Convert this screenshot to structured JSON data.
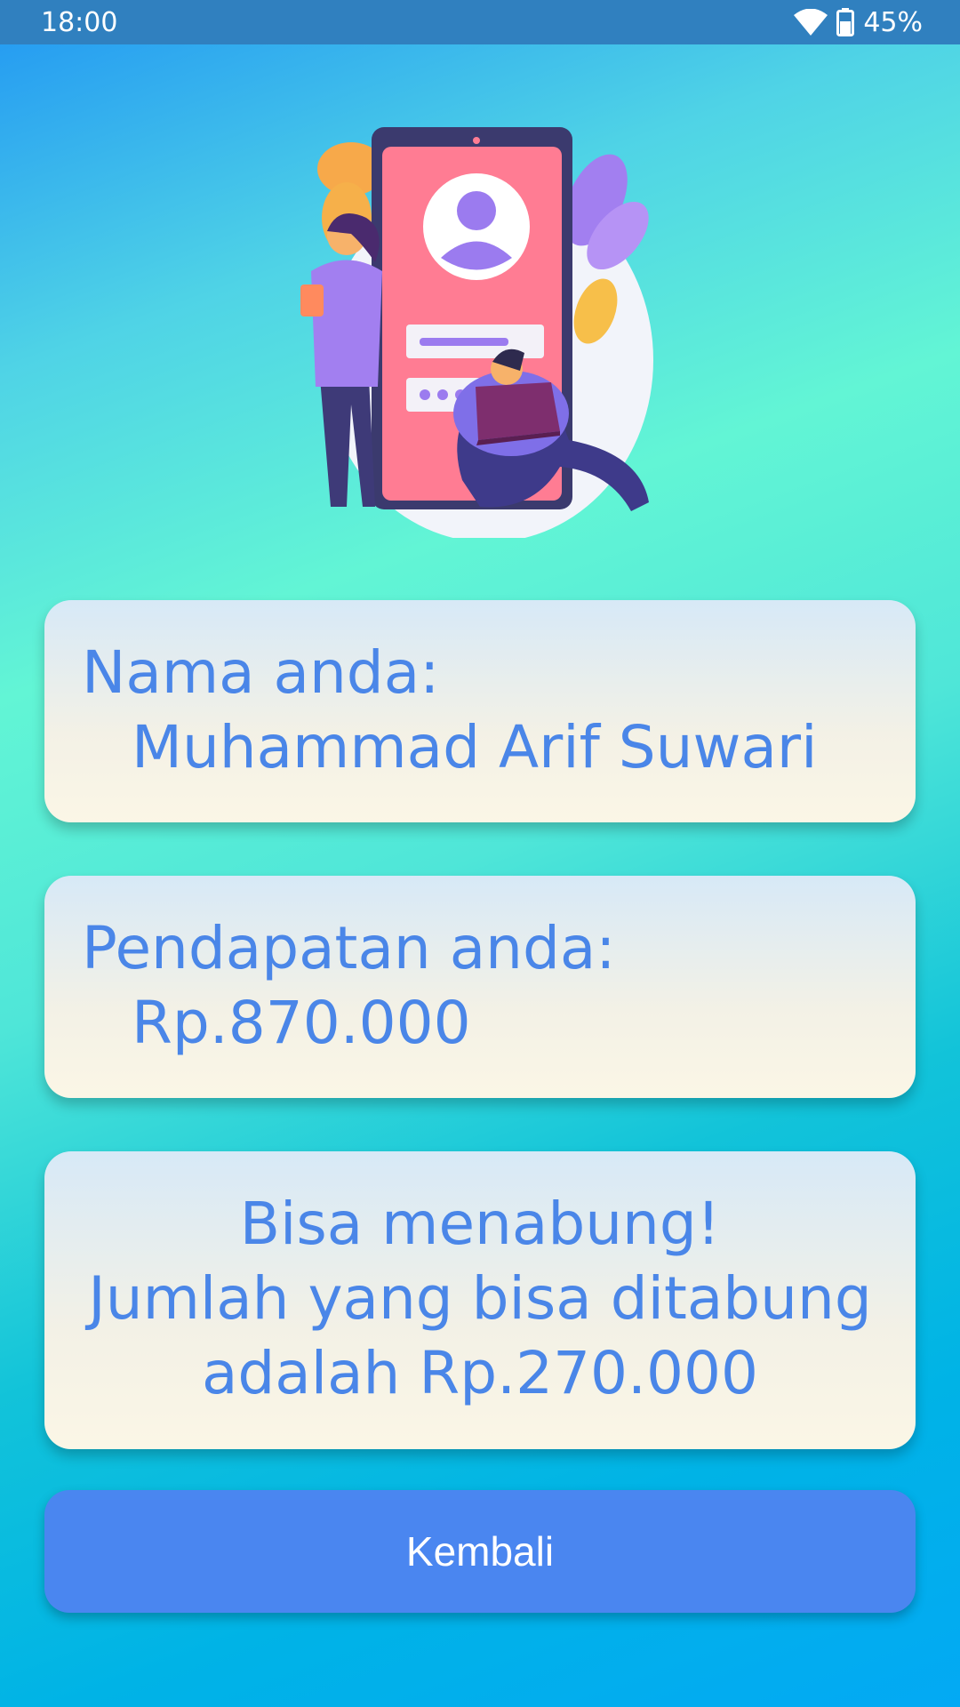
{
  "status_bar": {
    "time": "18:00",
    "battery": "45%"
  },
  "name_card": {
    "label": "Nama anda:",
    "value": "Muhammad Arif Suwari"
  },
  "income_card": {
    "label": "Pendapatan anda:",
    "value": "Rp.870.000"
  },
  "result_card": {
    "line1": "Bisa menabung!",
    "line2": "Jumlah yang bisa ditabung",
    "line3": "adalah Rp.270.000"
  },
  "back_button": {
    "label": "Kembali"
  },
  "colors": {
    "accent": "#4a86e8",
    "button": "#4a86f0",
    "status_bar": "#3080bf"
  }
}
